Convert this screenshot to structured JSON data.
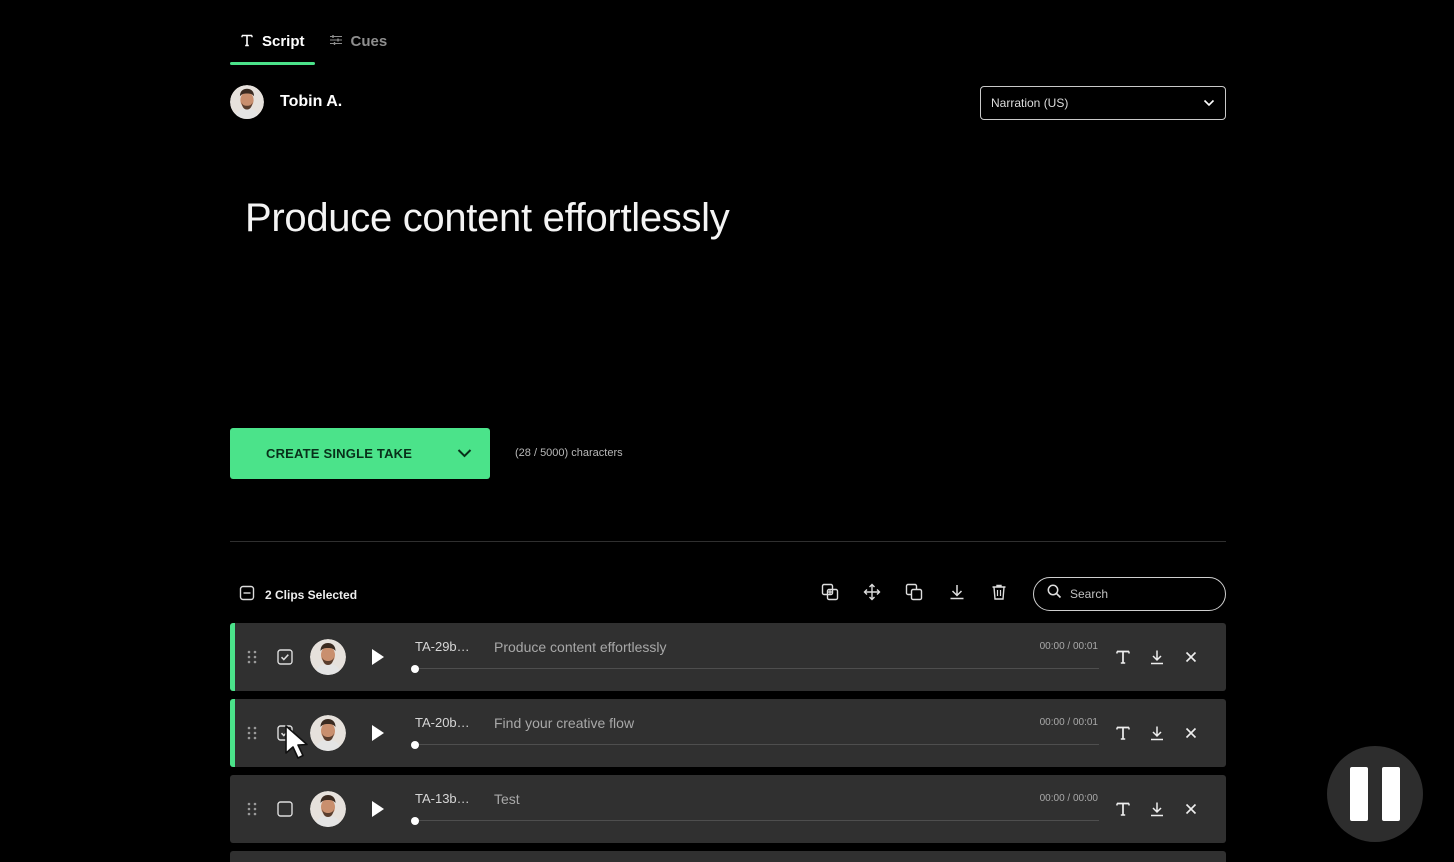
{
  "tabs": [
    {
      "label": "Script",
      "icon": "text-icon",
      "active": true
    },
    {
      "label": "Cues",
      "icon": "sliders-icon",
      "active": false
    }
  ],
  "speaker": {
    "name": "Tobin A."
  },
  "voice_select": {
    "value": "Narration (US)"
  },
  "script": {
    "text": "Produce content effortlessly"
  },
  "create": {
    "label": "CREATE SINGLE TAKE",
    "char_count": "(28 / 5000) characters"
  },
  "toolbar": {
    "selection_label": "2 Clips Selected",
    "tools": [
      "merge-icon",
      "move-icon",
      "duplicate-icon",
      "download-icon",
      "trash-icon"
    ],
    "search_placeholder": "Search"
  },
  "clips": [
    {
      "id": "TA-29b…",
      "text": "Produce content effortlessly",
      "time": "00:00 / 00:01",
      "checked": true,
      "progress": 0
    },
    {
      "id": "TA-20b…",
      "text": "Find your creative flow",
      "time": "00:00 / 00:01",
      "checked": true,
      "progress": 0
    },
    {
      "id": "TA-13b…",
      "text": "Test",
      "time": "00:00 / 00:00",
      "checked": false,
      "progress": 0
    }
  ],
  "colors": {
    "accent": "#4be38a",
    "row_bg": "#303030",
    "background": "#000000"
  }
}
